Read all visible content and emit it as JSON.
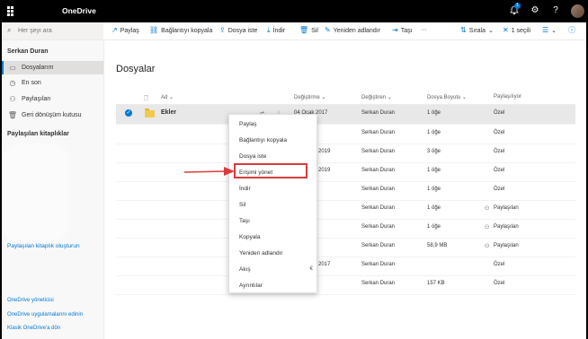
{
  "topbar": {
    "app_name": "OneDrive",
    "notification_count": "1"
  },
  "search": {
    "placeholder": "Her şeyi ara"
  },
  "commands": {
    "share": "Paylaş",
    "copy_link": "Bağlantıyı kopyala",
    "request_file": "Dosya iste",
    "download": "İndir",
    "delete": "Sil",
    "rename": "Yeniden adlandır",
    "move": "Taşı",
    "more": "···",
    "sort": "Sırala",
    "selected": "1 seçili"
  },
  "sidebar": {
    "user": "Serkan Duran",
    "items": [
      {
        "label": "Dosyalarım",
        "icon": "folder-icon"
      },
      {
        "label": "En son",
        "icon": "clock-icon"
      },
      {
        "label": "Paylaşılan",
        "icon": "people-icon"
      },
      {
        "label": "Geri dönüşüm kutusu",
        "icon": "recycle-bin-icon"
      }
    ],
    "shared_libraries": "Paylaşılan kitaplıklar",
    "create_library": "Paylaşılan kitaplık oluşturun",
    "footer_links": [
      "OneDrive yöneticisi",
      "OneDrive uygulamalarını edinin",
      "Klasik OneDrive'a dön"
    ]
  },
  "main": {
    "title": "Dosyalar",
    "columns": [
      "Ad",
      "Değiştirme",
      "Değiştiren",
      "Dosya Boyutu",
      "Paylaşılıyor"
    ],
    "rows": [
      {
        "name": "Ekler",
        "modified": "04 Ocak 2017",
        "modified_by": "Serkan Duran",
        "size": "1 öğe",
        "sharing": "Özel"
      },
      {
        "name": "",
        "modified": "",
        "modified_by": "Serkan Duran",
        "size": "1 öğe",
        "sharing": "Özel"
      },
      {
        "name": "",
        "modified": "2019",
        "modified_by": "Serkan Duran",
        "size": "3 öğe",
        "sharing": "Özel"
      },
      {
        "name": "",
        "modified": "2019",
        "modified_by": "Serkan Duran",
        "size": "1 öğe",
        "sharing": "Özel"
      },
      {
        "name": "",
        "modified": "",
        "modified_by": "Serkan Duran",
        "size": "1 öğe",
        "sharing": "Özel"
      },
      {
        "name": "",
        "modified": "",
        "modified_by": "Serkan Duran",
        "size": "1 öğe",
        "sharing": "Paylaşılan"
      },
      {
        "name": "",
        "modified": "",
        "modified_by": "Serkan Duran",
        "size": "1 öğe",
        "sharing": "Paylaşılan"
      },
      {
        "name": "",
        "modified": "",
        "modified_by": "Serkan Duran",
        "size": "58,9 MB",
        "sharing": "Paylaşılan"
      },
      {
        "name": "",
        "modified": "2017",
        "modified_by": "Serkan Duran",
        "size": "",
        "sharing": "Özel"
      },
      {
        "name": "",
        "modified": "",
        "modified_by": "Serkan Duran",
        "size": "157 KB",
        "sharing": "Özel"
      }
    ]
  },
  "context_menu": {
    "items": [
      "Paylaş",
      "Bağlantıyı kopyala",
      "Dosya iste",
      "Erişimi yönet",
      "İndir",
      "Sil",
      "Taşı",
      "Kopyala",
      "Yeniden adlandır",
      "Akış",
      "Ayrıntılar"
    ],
    "highlighted": "Erişimi yönet",
    "flow_symbol": "€"
  },
  "colors": {
    "accent": "#0078d4",
    "highlight": "#d93a3a",
    "topbar": "#000000"
  }
}
